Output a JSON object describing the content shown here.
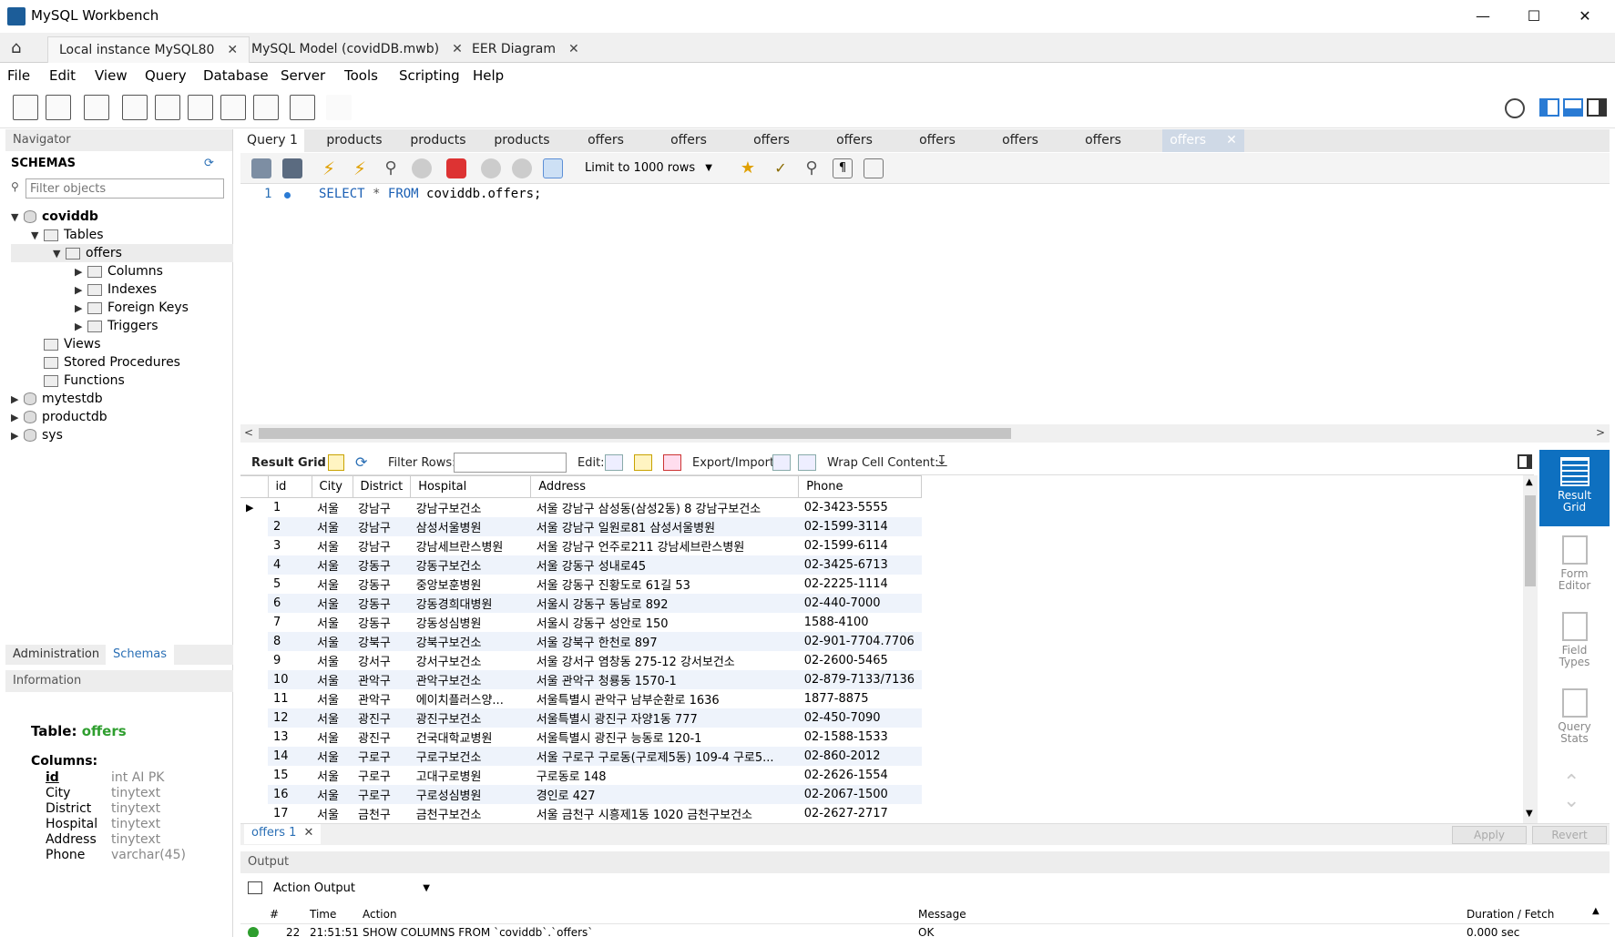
{
  "window": {
    "title": "MySQL Workbench"
  },
  "doc_tabs": [
    "Local instance MySQL80",
    "MySQL Model (covidDB.mwb)",
    "EER Diagram"
  ],
  "menu": [
    "File",
    "Edit",
    "View",
    "Query",
    "Database",
    "Server",
    "Tools",
    "Scripting",
    "Help"
  ],
  "navigator": {
    "header": "Navigator",
    "schemas_label": "SCHEMAS",
    "filter_placeholder": "Filter objects",
    "tree": {
      "db1": "coviddb",
      "tables": "Tables",
      "table": "offers",
      "columns": "Columns",
      "indexes": "Indexes",
      "foreign_keys": "Foreign Keys",
      "triggers": "Triggers",
      "views": "Views",
      "stored_procedures": "Stored Procedures",
      "functions": "Functions",
      "db2": "mytestdb",
      "db3": "productdb",
      "db4": "sys"
    },
    "tab_admin": "Administration",
    "tab_schemas": "Schemas",
    "info_header": "Information",
    "info": {
      "table_label": "Table:",
      "table_name": "offers",
      "columns_label": "Columns:",
      "columns": [
        {
          "name": "id",
          "type": "int AI PK"
        },
        {
          "name": "City",
          "type": "tinytext"
        },
        {
          "name": "District",
          "type": "tinytext"
        },
        {
          "name": "Hospital",
          "type": "tinytext"
        },
        {
          "name": "Address",
          "type": "tinytext"
        },
        {
          "name": "Phone",
          "type": "varchar(45)"
        }
      ]
    }
  },
  "query_tabs": [
    "Query 1",
    "products",
    "products",
    "products",
    "offers",
    "offers",
    "offers",
    "offers",
    "offers",
    "offers",
    "offers",
    "offers"
  ],
  "sql_toolbar": {
    "limit": "Limit to 1000 rows"
  },
  "editor": {
    "line_no": "1",
    "kw1": "SELECT",
    "star": "*",
    "kw2": "FROM",
    "target": "coviddb.offers;"
  },
  "grid_toolbar": {
    "result_grid": "Result Grid",
    "filter_rows": "Filter Rows:",
    "edit": "Edit:",
    "export_import": "Export/Import:",
    "wrap": "Wrap Cell Content:"
  },
  "grid": {
    "columns": [
      "id",
      "City",
      "District",
      "Hospital",
      "Address",
      "Phone"
    ],
    "rows": [
      [
        "1",
        "서울",
        "강남구",
        "강남구보건소",
        "서울 강남구 삼성동(삼성2동) 8 강남구보건소",
        "02-3423-5555"
      ],
      [
        "2",
        "서울",
        "강남구",
        "삼성서울병원",
        "서울 강남구 일원로81 삼성서울병원",
        "02-1599-3114"
      ],
      [
        "3",
        "서울",
        "강남구",
        "강남세브란스병원",
        "서울 강남구 언주로211 강남세브란스병원",
        "02-1599-6114"
      ],
      [
        "4",
        "서울",
        "강동구",
        "강동구보건소",
        "서울 강동구 성내로45",
        "02-3425-6713"
      ],
      [
        "5",
        "서울",
        "강동구",
        "중앙보훈병원",
        "서울 강동구 진황도로 61길 53",
        "02-2225-1114"
      ],
      [
        "6",
        "서울",
        "강동구",
        "강동경희대병원",
        "서울시 강동구 동남로 892",
        "02-440-7000"
      ],
      [
        "7",
        "서울",
        "강동구",
        "강동성심병원",
        "서울시 강동구 성안로 150",
        "1588-4100"
      ],
      [
        "8",
        "서울",
        "강북구",
        "강북구보건소",
        "서울 강북구 한천로 897",
        "02-901-7704.7706"
      ],
      [
        "9",
        "서울",
        "강서구",
        "강서구보건소",
        "서울 강서구 염창동 275-12 강서보건소",
        "02-2600-5465"
      ],
      [
        "10",
        "서울",
        "관악구",
        "관악구보건소",
        "서울 관악구 청룡동 1570-1",
        "02-879-7133/7136"
      ],
      [
        "11",
        "서울",
        "관악구",
        "에이치플러스양...",
        "서울특별시 관악구 남부순환로 1636",
        "1877-8875"
      ],
      [
        "12",
        "서울",
        "광진구",
        "광진구보건소",
        "서울특별시 광진구 자양1동 777",
        "02-450-7090"
      ],
      [
        "13",
        "서울",
        "광진구",
        "건국대학교병원",
        "서울특별시 광진구 능동로 120-1",
        "02-1588-1533"
      ],
      [
        "14",
        "서울",
        "구로구",
        "구로구보건소",
        "서울 구로구 구로동(구로제5동) 109-4 구로5...",
        "02-860-2012"
      ],
      [
        "15",
        "서울",
        "구로구",
        "고대구로병원",
        "구로동로 148",
        "02-2626-1554"
      ],
      [
        "16",
        "서울",
        "구로구",
        "구로성심병원",
        "경인로 427",
        "02-2067-1500"
      ],
      [
        "17",
        "서울",
        "금천구",
        "금천구보건소",
        "서울 금천구 시흥제1동 1020 금천구보건소",
        "02-2627-2717"
      ]
    ]
  },
  "side_panel": [
    {
      "line1": "Result",
      "line2": "Grid"
    },
    {
      "line1": "Form",
      "line2": "Editor"
    },
    {
      "line1": "Field",
      "line2": "Types"
    },
    {
      "line1": "Query",
      "line2": "Stats"
    }
  ],
  "result_tab": "offers 1",
  "buttons": {
    "apply": "Apply",
    "revert": "Revert"
  },
  "output": {
    "header": "Output",
    "selector": "Action Output",
    "columns": [
      "#",
      "Time",
      "Action",
      "Message",
      "Duration / Fetch"
    ],
    "row": [
      "22",
      "21:51:51",
      "SHOW COLUMNS FROM `coviddb`.`offers`",
      "OK",
      "0.000 sec"
    ]
  },
  "colors": {
    "accent": "#0e70c0",
    "keyword": "#1a5fb4",
    "info_green": "#2e9e2e"
  }
}
